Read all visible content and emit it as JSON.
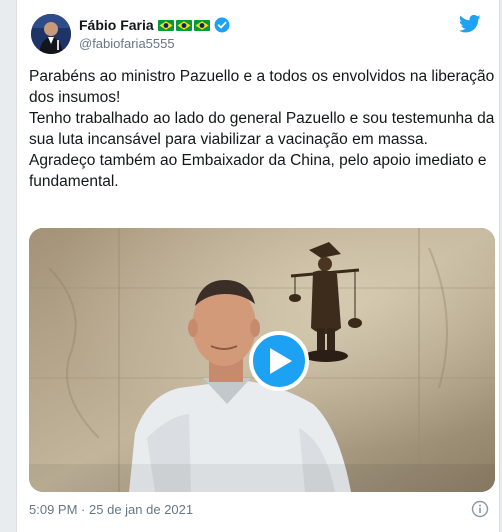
{
  "author": {
    "display_name": "Fábio Faria",
    "handle": "@fabiofaria5555",
    "flags": [
      "brazil-flag",
      "brazil-flag",
      "brazil-flag"
    ],
    "verified": true
  },
  "tweet": {
    "lines": [
      "Parabéns ao ministro Pazuello e a todos os envolvidos na liberação dos insumos!",
      "Tenho trabalhado ao lado do general Pazuello e sou testemunha da sua luta incansável para viabilizar a vacinação em massa.",
      "Agradeço também ao Embaixador da China, pelo apoio imediato e fundamental."
    ],
    "time": "5:09 PM",
    "separator": "·",
    "date": "25 de jan de 2021"
  },
  "media": {
    "type": "video",
    "play_icon": "play-icon"
  },
  "icons": {
    "logo": "twitter-bird-icon",
    "info": "info-icon"
  },
  "colors": {
    "accent": "#1da1f2",
    "text": "#14171a",
    "secondary_text": "#657786",
    "flag_green": "#009c3b",
    "flag_yellow": "#ffdf00",
    "flag_blue": "#002776"
  }
}
